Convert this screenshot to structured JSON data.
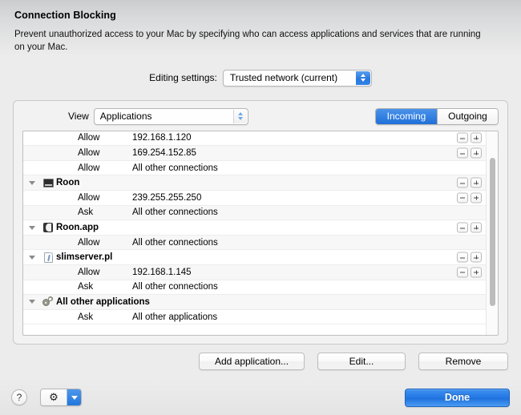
{
  "header": {
    "title": "Connection Blocking",
    "description": "Prevent unauthorized access to your Mac by specifying who can access applications and services that are running on your Mac."
  },
  "editing_settings": {
    "label": "Editing settings:",
    "selected": "Trusted network (current)"
  },
  "view": {
    "label": "View",
    "selected": "Applications"
  },
  "direction_segmented": {
    "options": [
      "Incoming",
      "Outgoing"
    ],
    "selected": "Incoming"
  },
  "list": {
    "rows": [
      {
        "kind": "rule",
        "action": "Allow",
        "target": "192.168.1.120",
        "buttons": true
      },
      {
        "kind": "rule",
        "action": "Allow",
        "target": "169.254.152.85",
        "buttons": true
      },
      {
        "kind": "rule",
        "action": "Allow",
        "target": "All other connections",
        "buttons": false
      },
      {
        "kind": "group",
        "name": "Roon",
        "icon": "monitor-icon",
        "buttons": true
      },
      {
        "kind": "rule",
        "action": "Allow",
        "target": "239.255.255.250",
        "buttons": true
      },
      {
        "kind": "rule",
        "action": "Ask",
        "target": "All other connections",
        "buttons": false
      },
      {
        "kind": "group",
        "name": "Roon.app",
        "icon": "app-icon",
        "buttons": true
      },
      {
        "kind": "rule",
        "action": "Allow",
        "target": "All other connections",
        "buttons": false
      },
      {
        "kind": "group",
        "name": "slimserver.pl",
        "icon": "document-icon",
        "buttons": true
      },
      {
        "kind": "rule",
        "action": "Allow",
        "target": "192.168.1.145",
        "buttons": true
      },
      {
        "kind": "rule",
        "action": "Ask",
        "target": "All other connections",
        "buttons": false
      },
      {
        "kind": "group",
        "name": "All other applications",
        "icon": "gears-icon",
        "buttons": false
      },
      {
        "kind": "rule",
        "action": "Ask",
        "target": "All other applications",
        "buttons": false
      }
    ]
  },
  "actions": {
    "add_application": "Add application...",
    "edit": "Edit...",
    "remove": "Remove"
  },
  "bottom": {
    "help": "?",
    "gear": "⚙",
    "done": "Done"
  },
  "colors": {
    "accent_blue": "#2377e4",
    "segment_active": "#2a80e6",
    "window_bg": "#ececec"
  }
}
